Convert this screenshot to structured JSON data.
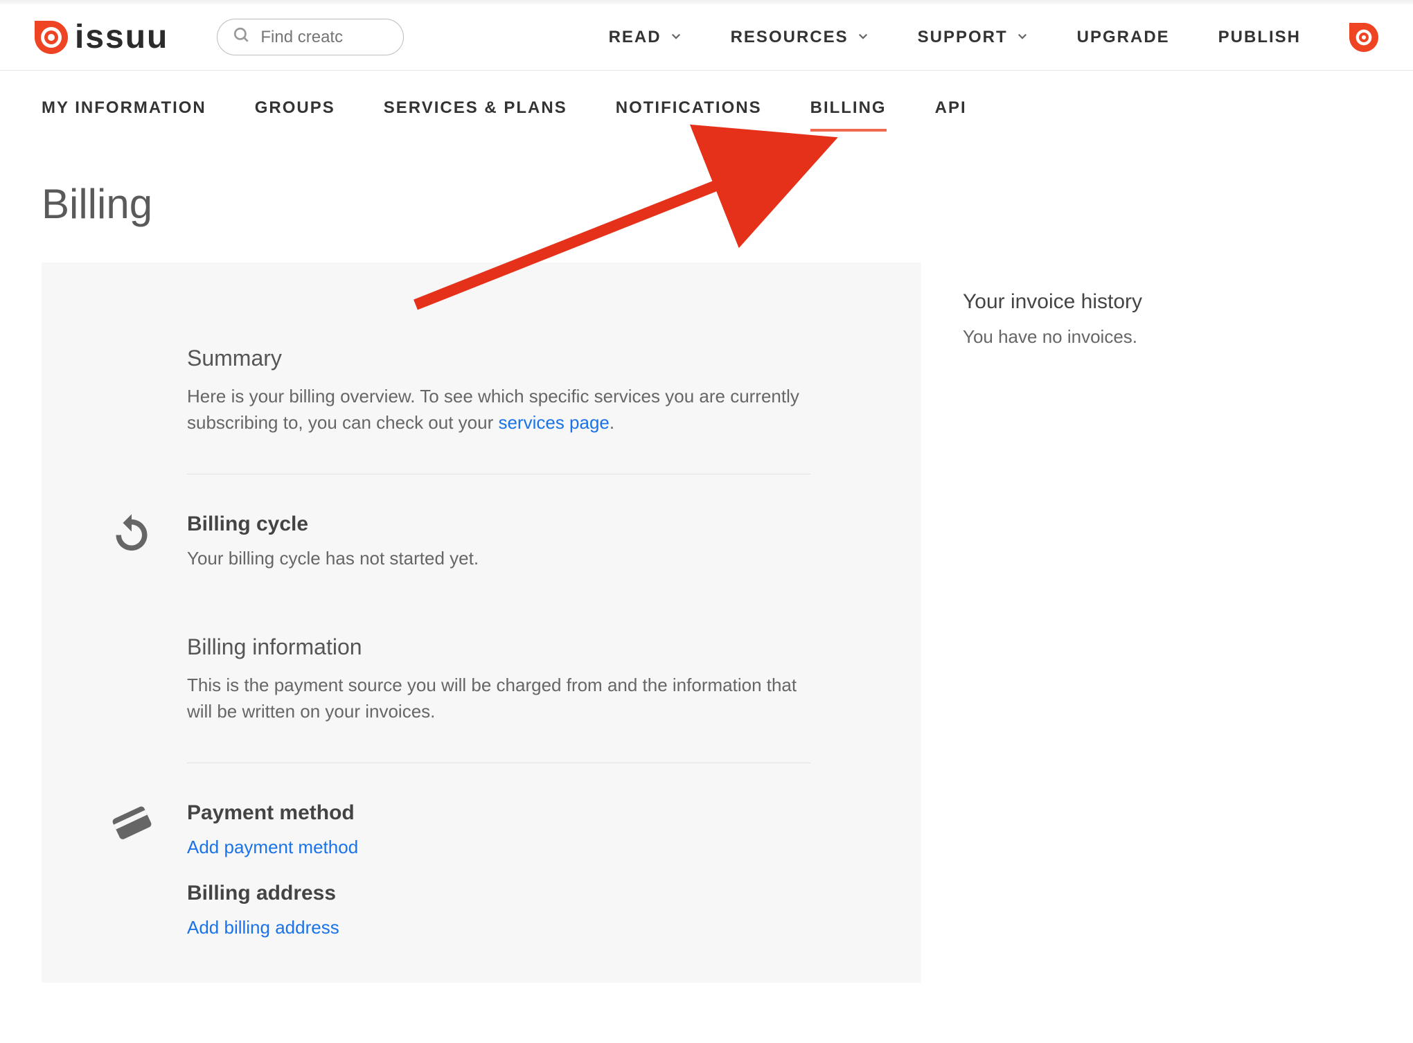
{
  "brand": {
    "name": "issuu"
  },
  "search": {
    "placeholder": "Find creatc"
  },
  "topnav": {
    "items": [
      {
        "label": "READ",
        "dropdown": true
      },
      {
        "label": "RESOURCES",
        "dropdown": true
      },
      {
        "label": "SUPPORT",
        "dropdown": true
      },
      {
        "label": "UPGRADE",
        "dropdown": false
      },
      {
        "label": "PUBLISH",
        "dropdown": false
      }
    ]
  },
  "subnav": {
    "items": [
      {
        "label": "MY INFORMATION",
        "active": false
      },
      {
        "label": "GROUPS",
        "active": false
      },
      {
        "label": "SERVICES & PLANS",
        "active": false
      },
      {
        "label": "NOTIFICATIONS",
        "active": false
      },
      {
        "label": "BILLING",
        "active": true
      },
      {
        "label": "API",
        "active": false
      }
    ]
  },
  "page": {
    "title": "Billing"
  },
  "summary": {
    "heading": "Summary",
    "text_before": "Here is your billing overview. To see which specific services you are currently subscribing to, you can check out your ",
    "link": "services page",
    "text_after": "."
  },
  "cycle": {
    "heading": "Billing cycle",
    "text": "Your billing cycle has not started yet."
  },
  "info": {
    "heading": "Billing information",
    "text": "This is the payment source you will be charged from and the information that will be written on your invoices."
  },
  "payment": {
    "method_heading": "Payment method",
    "method_link": "Add payment method",
    "address_heading": "Billing address",
    "address_link": "Add billing address"
  },
  "invoices": {
    "heading": "Your invoice history",
    "empty": "You have no invoices."
  },
  "colors": {
    "accent": "#ef4423",
    "link": "#1a73e8"
  }
}
